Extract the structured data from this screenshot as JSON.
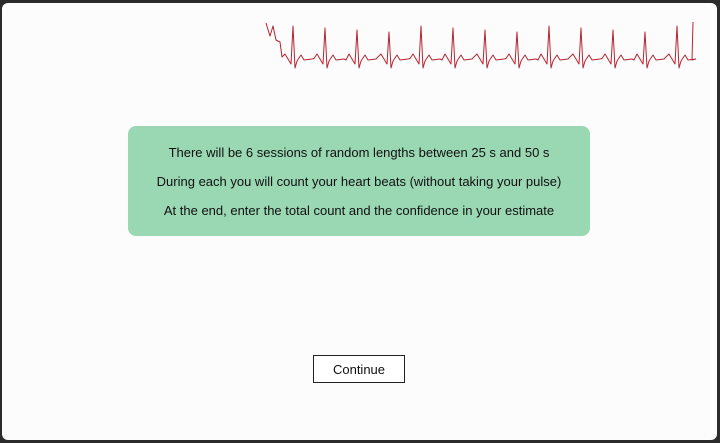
{
  "instructions": {
    "lines": [
      "There will be 6 sessions of random lengths between 25 s and 50 s",
      "During each you will count your heart beats (without taking your pulse)",
      "At the end, enter the total count and the confidence in your estimate"
    ]
  },
  "actions": {
    "continue_label": "Continue"
  },
  "colors": {
    "window_background": "#fcfcfc",
    "info_box_background": "#9ad7b3",
    "ecg_trace": "#b5242f"
  },
  "ecg": {
    "beats": 13
  }
}
